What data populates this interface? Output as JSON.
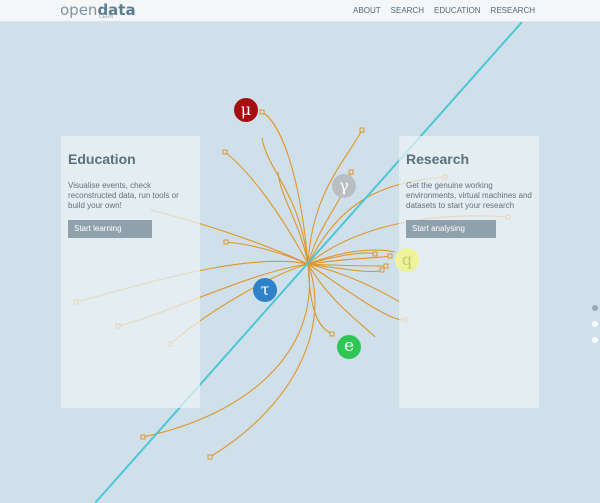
{
  "header": {
    "logo_light": "open",
    "logo_bold": "data",
    "logo_sub": "CERN",
    "nav": [
      "ABOUT",
      "SEARCH",
      "EDUCATION",
      "RESEARCH"
    ]
  },
  "education": {
    "title": "Education",
    "text": "Visualise events, check reconstructed data, run tools or build your own!",
    "button": "Start learning"
  },
  "research": {
    "title": "Research",
    "text": "Get the genuine working environments, virtual machines and datasets to start your research",
    "button": "Start analysing"
  },
  "particles": [
    {
      "symbol": "μ",
      "color": "#a50f0f"
    },
    {
      "symbol": "γ",
      "color": "#b9bec2"
    },
    {
      "symbol": "q",
      "color": "#eef29a"
    },
    {
      "symbol": "τ",
      "color": "#2f82c9"
    },
    {
      "symbol": "e",
      "color": "#2fc655"
    }
  ],
  "colors": {
    "background": "#cfe0ea",
    "track": "#e0962a",
    "beam": "#4cc6d6"
  },
  "carousel": {
    "active_index": 0,
    "count": 3
  }
}
